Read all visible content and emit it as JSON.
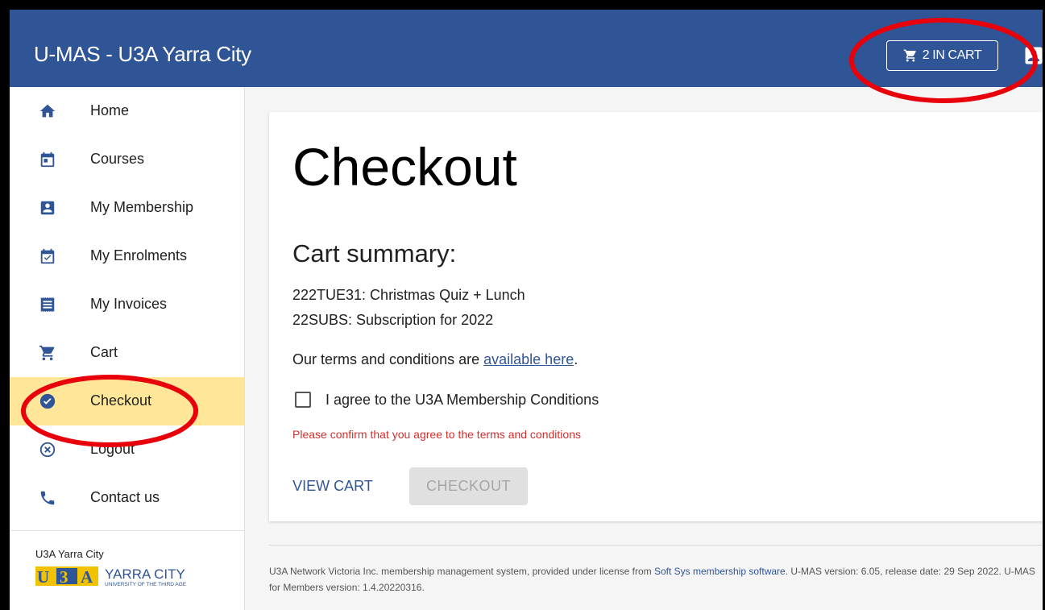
{
  "header": {
    "app_title": "U-MAS - U3A Yarra City",
    "cart_button_label": "2 IN CART",
    "cart_icon": "shopping-cart-icon",
    "account_icon": "account-box-icon"
  },
  "sidebar": {
    "items": [
      {
        "label": "Home",
        "icon": "home-icon"
      },
      {
        "label": "Courses",
        "icon": "calendar-icon"
      },
      {
        "label": "My Membership",
        "icon": "account-box-icon"
      },
      {
        "label": "My Enrolments",
        "icon": "calendar-check-icon"
      },
      {
        "label": "My Invoices",
        "icon": "receipt-icon"
      },
      {
        "label": "Cart",
        "icon": "cart-icon"
      },
      {
        "label": "Checkout",
        "icon": "check-circle-icon",
        "active": true
      },
      {
        "label": "Logout",
        "icon": "cancel-circle-icon"
      },
      {
        "label": "Contact us",
        "icon": "phone-icon"
      }
    ],
    "org_name": "U3A Yarra City",
    "logo": {
      "badge": "U3A",
      "name": "YARRA CITY",
      "tagline": "UNIVERSITY OF THE THIRD AGE"
    }
  },
  "main": {
    "title": "Checkout",
    "cart_summary_heading": "Cart summary:",
    "cart_items": [
      "222TUE31: Christmas Quiz + Lunch",
      "22SUBS: Subscription for 2022"
    ],
    "terms_prefix": "Our terms and conditions are ",
    "terms_link": "available here",
    "terms_suffix": ".",
    "agree_label": "I agree to the U3A Membership Conditions",
    "agree_checked": false,
    "error_message": "Please confirm that you agree to the terms and conditions",
    "view_cart_label": "VIEW CART",
    "checkout_label": "CHECKOUT"
  },
  "footer": {
    "text1": "U3A Network Victoria Inc. membership management system, provided under license from ",
    "link": "Soft Sys membership software",
    "text2": ". U-MAS version: 6.05, release date: 29 Sep 2022. U-MAS for Members version: 1.4.20220316."
  },
  "colors": {
    "header_bg": "#2f5597",
    "active_nav_bg": "#ffe699",
    "error": "#d32f2f",
    "annotation": "#e8000b"
  }
}
